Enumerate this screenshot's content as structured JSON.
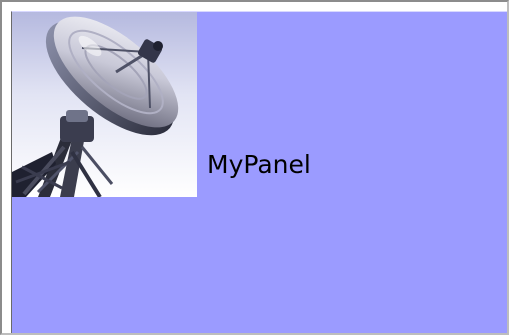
{
  "panel": {
    "label": "MyPanel",
    "background_color": "#9b9bff",
    "icon": "satellite-dish-icon"
  }
}
